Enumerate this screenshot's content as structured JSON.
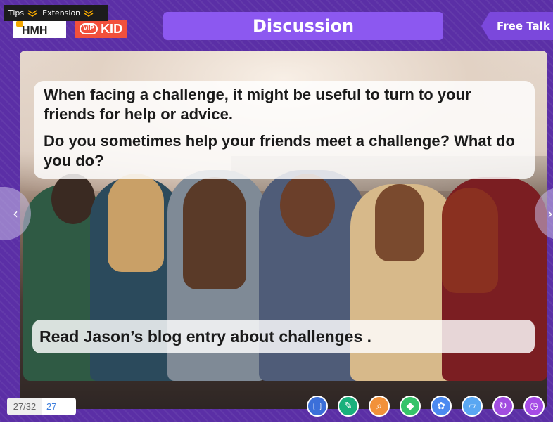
{
  "topbar": {
    "tips_label": "Tips",
    "extension_label": "Extension"
  },
  "logos": {
    "hmh": "HMH",
    "vipkid_vip": "VIP",
    "vipkid_kid": "KID"
  },
  "header": {
    "title": "Discussion",
    "free_talk_label": "Free Talk"
  },
  "slide": {
    "prompt_line1": "When facing a challenge, it might be useful to turn to your friends for help or advice.",
    "prompt_line2": "Do you sometimes help your friends meet a challenge? What do you do?",
    "task": "Read Jason’s blog entry about challenges ."
  },
  "pagination": {
    "current_of_total": "27/32",
    "input_value": "27"
  },
  "toolbar": {
    "icons": [
      "courseware-icon",
      "tools-icon",
      "search-icon",
      "sticker-icon",
      "palette-icon",
      "eraser-icon",
      "refresh-icon",
      "timer-icon"
    ],
    "colors": [
      "#3b6fd9",
      "#19b07c",
      "#f2913a",
      "#36c36a",
      "#4b89f0",
      "#5aa7f2",
      "#a24de0",
      "#a64be6"
    ]
  }
}
